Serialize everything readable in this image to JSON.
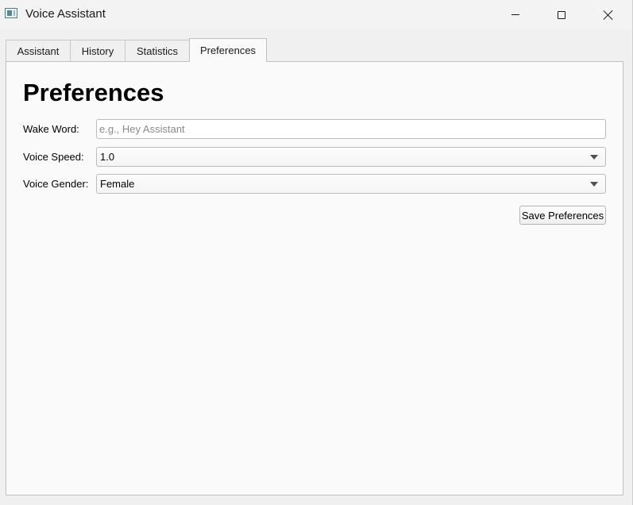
{
  "window": {
    "title": "Voice Assistant",
    "icon": "app-window-icon",
    "controls": [
      "minimize-icon",
      "maximize-icon",
      "close-icon"
    ]
  },
  "tabs": [
    {
      "label": "Assistant",
      "active": false
    },
    {
      "label": "History",
      "active": false
    },
    {
      "label": "Statistics",
      "active": false
    },
    {
      "label": "Preferences",
      "active": true
    }
  ],
  "preferences": {
    "heading": "Preferences",
    "wake_word": {
      "label": "Wake Word:",
      "value": "",
      "placeholder": "e.g., Hey Assistant"
    },
    "voice_speed": {
      "label": "Voice Speed:",
      "selected": "1.0"
    },
    "voice_gender": {
      "label": "Voice Gender:",
      "selected": "Female"
    },
    "save_label": "Save Preferences"
  },
  "colors": {
    "window_bg": "#f0f0f0",
    "panel_bg": "#fafafa",
    "border": "#c0c0c0"
  }
}
